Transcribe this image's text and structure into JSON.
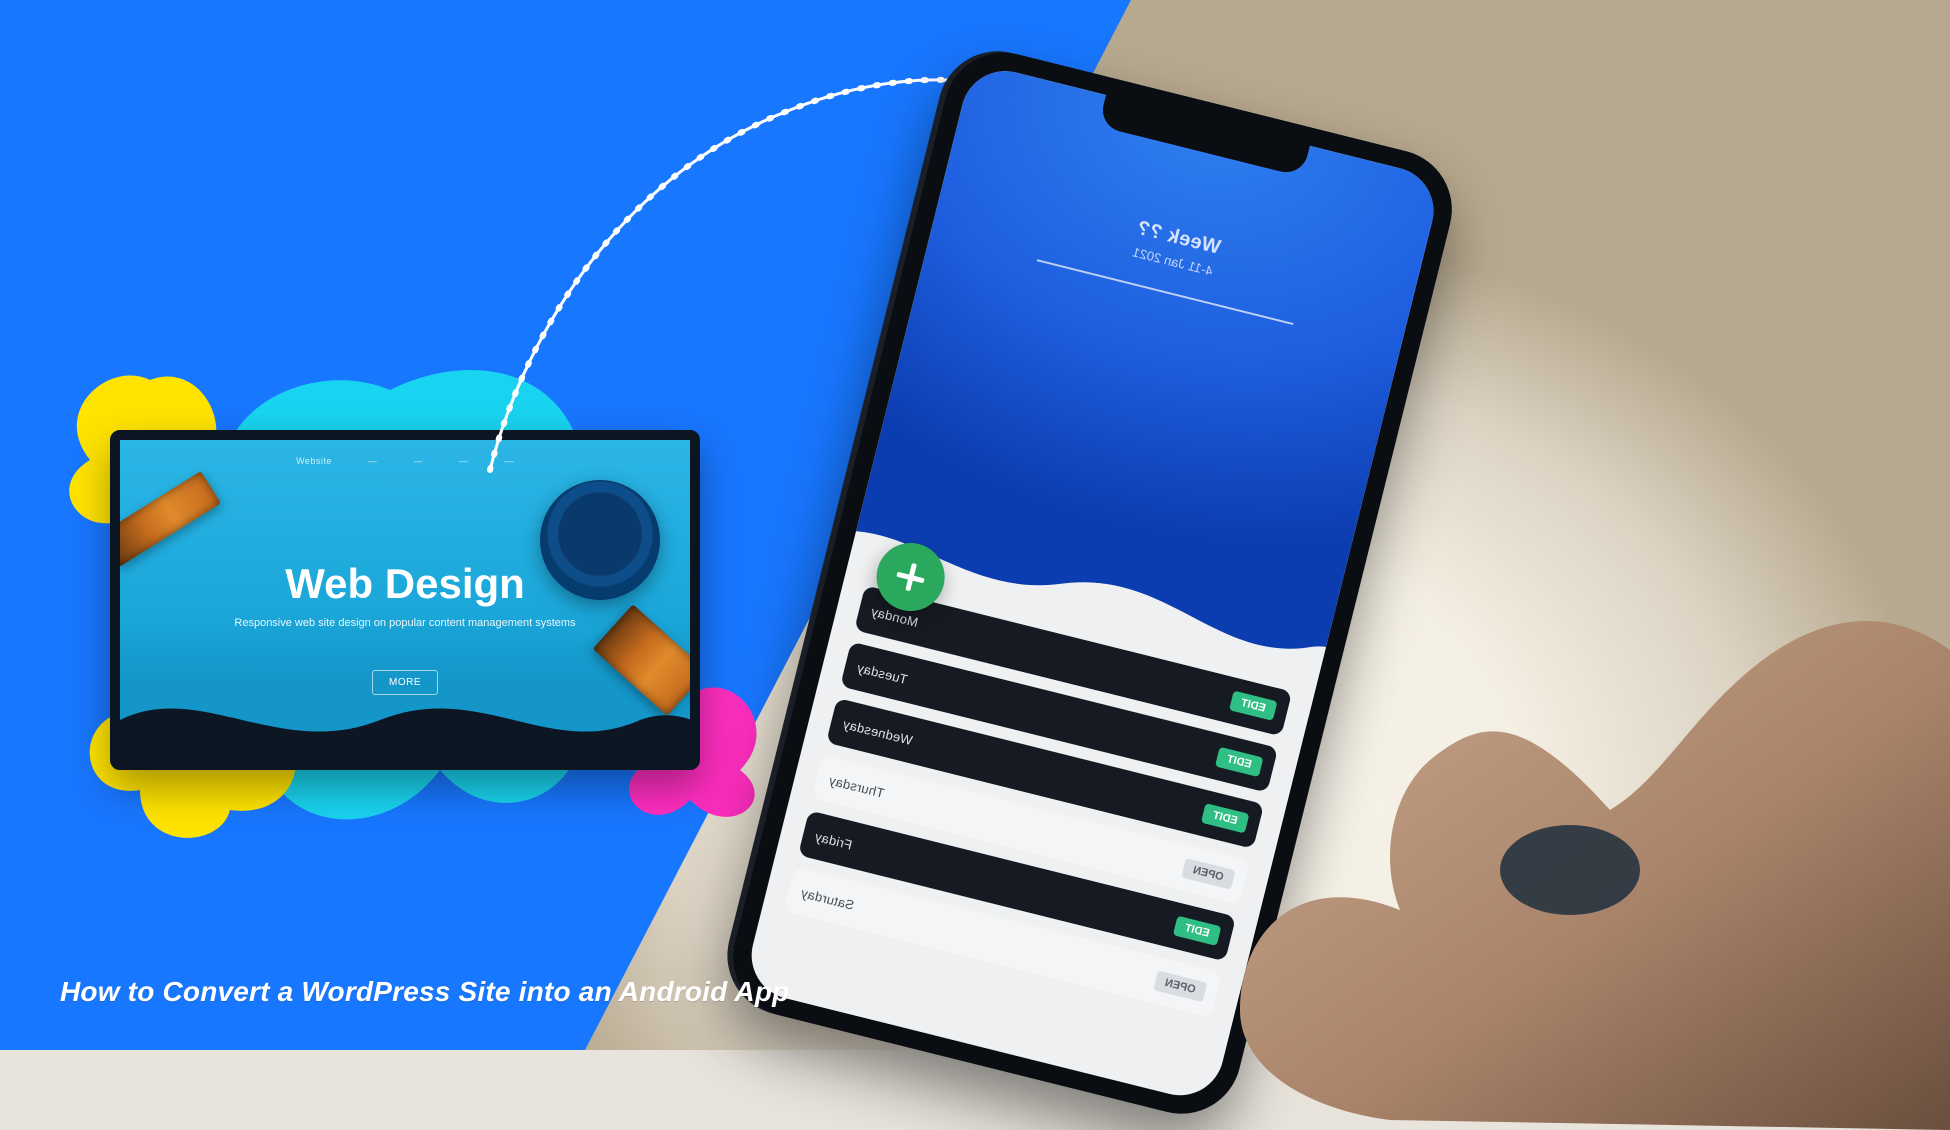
{
  "colors": {
    "panel_blue": "#1877ff",
    "splat_cyan": "#19d4f0",
    "splat_yellow": "#ffe400",
    "splat_magenta": "#ff2ec0",
    "fab_green": "#2aa95e"
  },
  "caption": "How to Convert a WordPress Site into an Android App",
  "tablet": {
    "nav_brand": "Website",
    "title": "Web Design",
    "subtitle": "Responsive web site design on popular content management systems",
    "cta": "MORE"
  },
  "phone": {
    "header_title": "Week ??",
    "header_subtitle": "4-11 Jan 2021",
    "fab_icon": "plus-icon",
    "rows": [
      {
        "label": "Monday",
        "chip": "EDIT",
        "variant": "dark"
      },
      {
        "label": "Tuesday",
        "chip": "EDIT",
        "variant": "dark"
      },
      {
        "label": "Wednesday",
        "chip": "EDIT",
        "variant": "dark"
      },
      {
        "label": "Thursday",
        "chip": "OPEN",
        "variant": "light"
      },
      {
        "label": "Friday",
        "chip": "EDIT",
        "variant": "dark"
      },
      {
        "label": "Saturday",
        "chip": "OPEN",
        "variant": "light"
      }
    ]
  }
}
